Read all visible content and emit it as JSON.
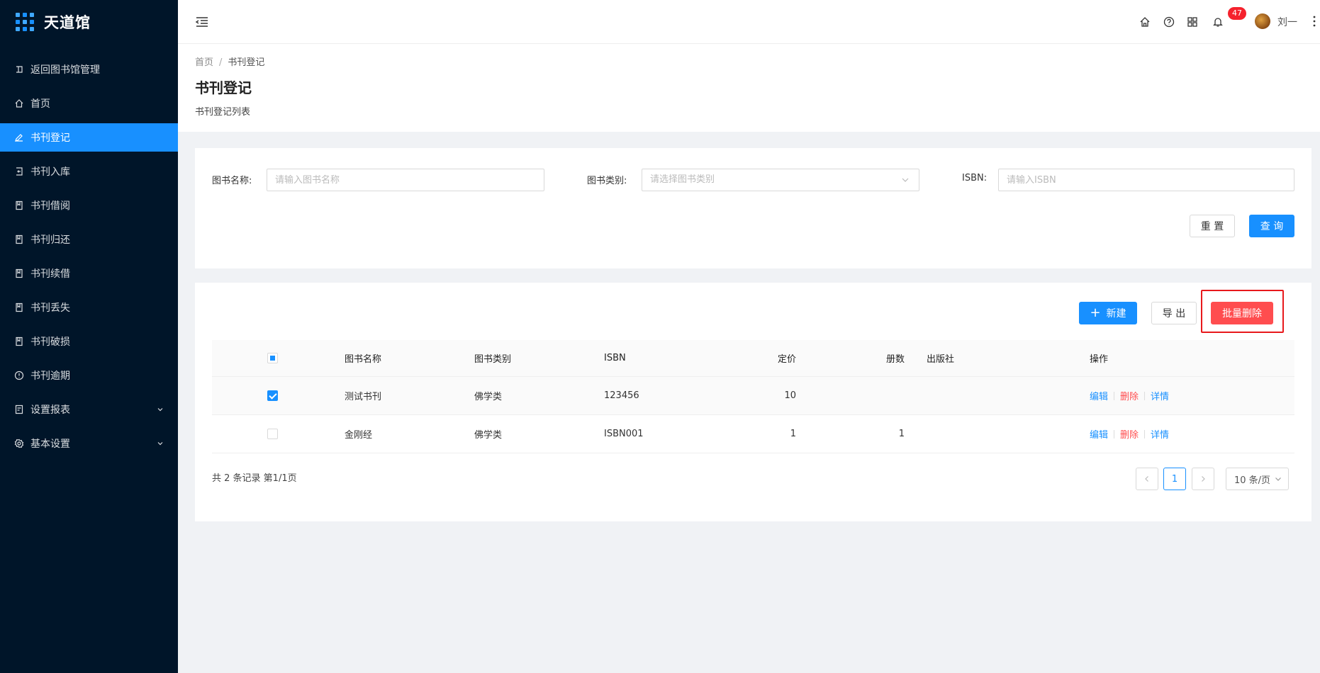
{
  "app": {
    "name": "天道馆"
  },
  "sidebar": {
    "items": [
      {
        "label": "返回图书馆管理",
        "icon": "return-icon"
      },
      {
        "label": "首页",
        "icon": "home-icon"
      },
      {
        "label": "书刊登记",
        "icon": "edit-icon",
        "active": true
      },
      {
        "label": "书刊入库",
        "icon": "import-icon"
      },
      {
        "label": "书刊借阅",
        "icon": "book-icon"
      },
      {
        "label": "书刊归还",
        "icon": "book-icon"
      },
      {
        "label": "书刊续借",
        "icon": "book-icon"
      },
      {
        "label": "书刊丢失",
        "icon": "book-icon"
      },
      {
        "label": "书刊破损",
        "icon": "book-icon"
      },
      {
        "label": "书刊逾期",
        "icon": "info-circle-icon"
      },
      {
        "label": "设置报表",
        "icon": "report-icon",
        "expandable": true
      },
      {
        "label": "基本设置",
        "icon": "settings-icon",
        "expandable": true
      }
    ]
  },
  "header": {
    "notification_count": "47",
    "username": "刘一"
  },
  "page": {
    "breadcrumb": [
      "首页",
      "书刊登记"
    ],
    "title": "书刊登记",
    "subtitle": "书刊登记列表"
  },
  "search": {
    "name_label": "图书名称:",
    "name_placeholder": "请输入图书名称",
    "category_label": "图书类别:",
    "category_placeholder": "请选择图书类别",
    "isbn_label": "ISBN:",
    "isbn_placeholder": "请输入ISBN",
    "reset_label": "重 置",
    "query_label": "查 询"
  },
  "toolbar": {
    "new_label": "新建",
    "export_label": "导 出",
    "batch_delete_label": "批量删除"
  },
  "table": {
    "columns": [
      "图书名称",
      "图书类别",
      "ISBN",
      "定价",
      "册数",
      "出版社",
      "操作"
    ],
    "rows": [
      {
        "checked": true,
        "name": "测试书刊",
        "category": "佛学类",
        "isbn": "123456",
        "price": "10",
        "count": "",
        "publisher": ""
      },
      {
        "checked": false,
        "name": "金刚经",
        "category": "佛学类",
        "isbn": "ISBN001",
        "price": "1",
        "count": "1",
        "publisher": ""
      }
    ],
    "actions": {
      "edit": "编辑",
      "delete": "删除",
      "detail": "详情"
    }
  },
  "pagination": {
    "total_text": "共 2 条记录 第1/1页",
    "current_page": "1",
    "page_size": "10 条/页"
  },
  "colors": {
    "primary": "#1890ff",
    "danger": "#ff4d4f",
    "sidebar_bg": "#001529",
    "highlight_box": "#e8191c"
  }
}
